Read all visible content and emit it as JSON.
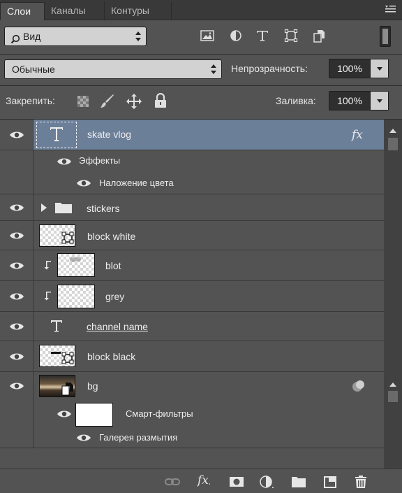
{
  "tabs": [
    {
      "label": "Слои",
      "active": true
    },
    {
      "label": "Каналы",
      "active": false
    },
    {
      "label": "Контуры",
      "active": false
    }
  ],
  "filter": {
    "kind_label": "Вид",
    "filter_icons": [
      "image-filter-icon",
      "adjustment-filter-icon",
      "text-filter-icon",
      "shape-filter-icon",
      "smart-object-filter-icon"
    ]
  },
  "blend": {
    "mode": "Обычные",
    "opacity_label": "Непрозрачность:",
    "opacity_value": "100%"
  },
  "lock": {
    "label": "Закрепить:",
    "fill_label": "Заливка:",
    "fill_value": "100%"
  },
  "layers": [
    {
      "name": "skate vlog",
      "type": "text",
      "selected": true,
      "fx": "fx",
      "effects_label": "Эффекты",
      "effects": [
        "Наложение цвета"
      ]
    },
    {
      "name": "stickers",
      "type": "group"
    },
    {
      "name": "block white",
      "type": "shape"
    },
    {
      "name": "blot",
      "type": "clipped"
    },
    {
      "name": "grey",
      "type": "clipped"
    },
    {
      "name": "channel name",
      "type": "text"
    },
    {
      "name": "block black",
      "type": "shape"
    },
    {
      "name": "bg",
      "type": "smart-object",
      "smart_filters_label": "Смарт-фильтры",
      "filters": [
        "Галерея размытия"
      ]
    }
  ],
  "bottom_icons": [
    "link-icon",
    "fx-icon",
    "mask-icon",
    "adjustment-icon",
    "folder-icon",
    "new-layer-icon",
    "trash-icon"
  ],
  "colors": {
    "panel": "#535353",
    "selection": "#6c7f99",
    "tabbar": "#393939"
  }
}
